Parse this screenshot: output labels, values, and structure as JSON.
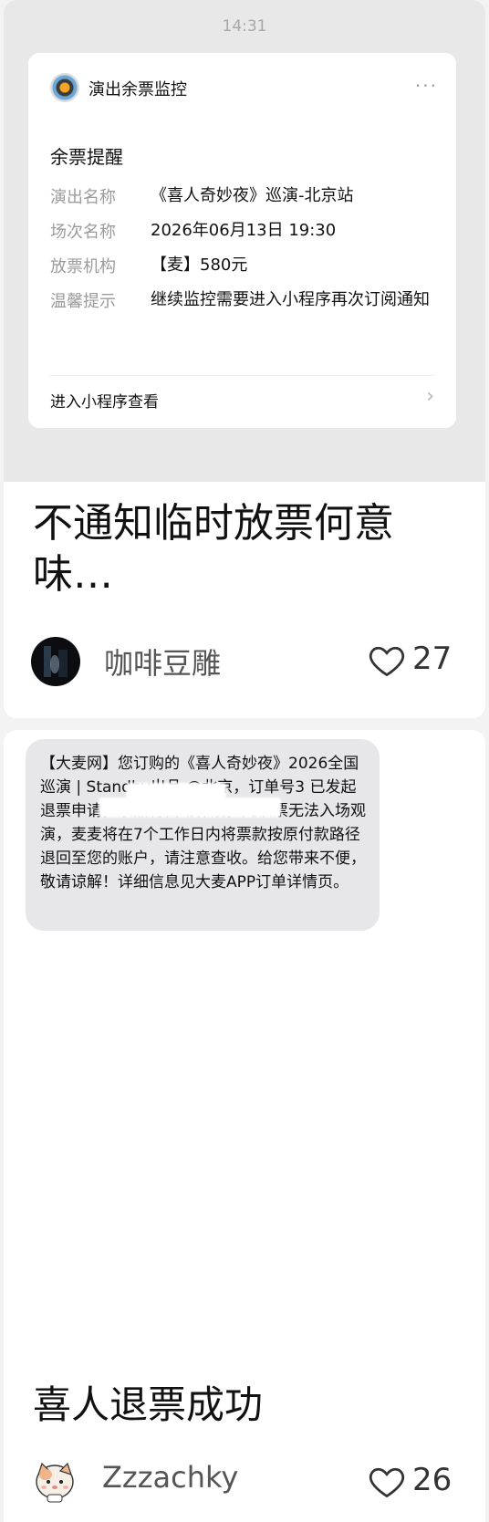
{
  "post1": {
    "status_time": "14:31",
    "notice": {
      "app_name": "演出余票监控",
      "more": "···",
      "title": "余票提醒",
      "fields": [
        {
          "label": "演出名称",
          "value": "《喜人奇妙夜》巡演-北京站"
        },
        {
          "label": "场次名称",
          "value": "2026年06月13日 19:30"
        },
        {
          "label": "放票机构",
          "value": "【麦】580元"
        },
        {
          "label": "温馨提示",
          "value": "继续监控需要进入小程序再次订阅通知"
        }
      ],
      "link": "进入小程序查看",
      "chevron": "›"
    },
    "title_line1": "不通知临时放票何意",
    "title_line2": "味…",
    "author": "咖啡豆雕",
    "likes": "27"
  },
  "post2": {
    "sms_text": "【大麦网】您订购的《喜人奇妙夜》2026全国巡演 | Standby出品 @北京，订单号3                              已发起退票申请，票品将自动作废，凭该票无法入场观演，麦麦将在7个工作日内将票款按原付款路径退回至您的账户，请注意查收。给您带来不便，敬请谅解！详细信息见大麦APP订单详情页。",
    "title": "喜人退票成功",
    "author": "Zzzachky",
    "likes": "26"
  },
  "icons": {
    "heart": "heart-icon",
    "more": "more-icon",
    "chevron": "chevron-right-icon"
  }
}
